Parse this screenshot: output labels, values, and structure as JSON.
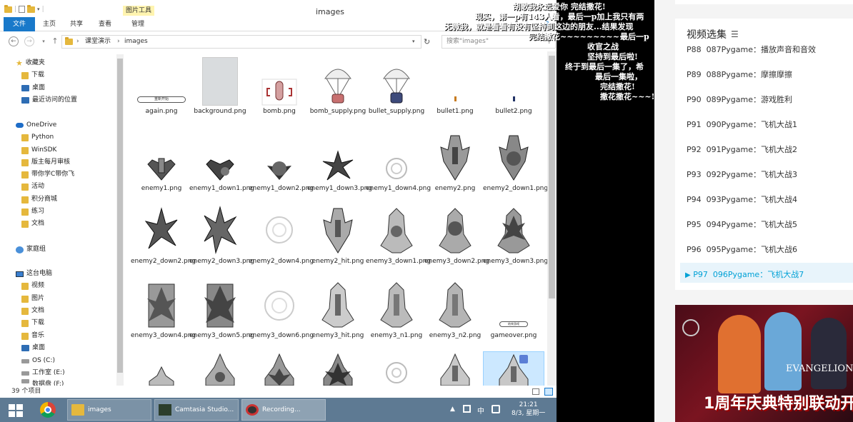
{
  "explorer": {
    "window_title": "images",
    "context_tab": "图片工具",
    "ribbon_tabs": [
      "文件",
      "主页",
      "共享",
      "查看",
      "管理"
    ],
    "breadcrumb": [
      "课堂演示",
      "images"
    ],
    "search_placeholder": "搜索\"images\"",
    "nav": {
      "favorites": "收藏夹",
      "fav_items": [
        "下载",
        "桌面",
        "最近访问的位置"
      ],
      "onedrive": "OneDrive",
      "od_items": [
        "Python",
        "WinSDK",
        "版主每月审核",
        "带你学C带你飞",
        "活动",
        "积分商城",
        "练习",
        "文档"
      ],
      "homegroup": "家庭组",
      "thispc": "这台电脑",
      "pc_items": [
        "视频",
        "图片",
        "文档",
        "下载",
        "音乐",
        "桌面",
        "OS (C:)",
        "工作室 (E:)",
        "数据盘 (F:)"
      ]
    },
    "files": [
      "again.png",
      "background.png",
      "bomb.png",
      "bomb_supply.png",
      "bullet_supply.png",
      "bullet1.png",
      "bullet2.png",
      "enemy1.png",
      "enemy1_down1.png",
      "enemy1_down2.png",
      "enemy1_down3.png",
      "enemy1_down4.png",
      "enemy2.png",
      "enemy2_down1.png",
      "enemy2_down2.png",
      "enemy2_down3.png",
      "enemy2_down4.png",
      "enemy2_hit.png",
      "enemy3_down1.png",
      "enemy3_down2.png",
      "enemy3_down3.png",
      "enemy3_down4.png",
      "enemy3_down5.png",
      "enemy3_down6.png",
      "enemy3_hit.png",
      "enemy3_n1.png",
      "enemy3_n2.png",
      "gameover.png"
    ],
    "again_label": "重新开始",
    "gameover_label": "结束游戏",
    "status": "39 个项目"
  },
  "taskbar": {
    "buttons": [
      "images",
      "Camtasia Studio...",
      "Recording..."
    ],
    "tray": "中",
    "time": "21:21",
    "date": "8/3, 星期一"
  },
  "danmaku": [
    "胡歌我永远爱你  完结撒花!",
    "现实，第一p有143人看，最后一p加上我只有两",
    "无微我，就是看看有没有坚持到这边的朋友...结果发现",
    "完结撒花~~~~~~~~~~~~~~~~~~~~~~~",
    "最后一p",
    "收官之战",
    "坚持到最后啦!",
    "终于到最后一集了，希",
    "最后一集啦，",
    "完结撒花!",
    "撒花撒花~~~!"
  ],
  "sidebar": {
    "playlist_title": "视频选集",
    "items": [
      {
        "p": "P88",
        "t": "087Pygame：播放声音和音效"
      },
      {
        "p": "P89",
        "t": "088Pygame：摩擦摩擦"
      },
      {
        "p": "P90",
        "t": "089Pygame：游戏胜利"
      },
      {
        "p": "P91",
        "t": "090Pygame：飞机大战1"
      },
      {
        "p": "P92",
        "t": "091Pygame：飞机大战2"
      },
      {
        "p": "P93",
        "t": "092Pygame：飞机大战3"
      },
      {
        "p": "P94",
        "t": "093Pygame：飞机大战4"
      },
      {
        "p": "P95",
        "t": "094Pygame：飞机大战5"
      },
      {
        "p": "P96",
        "t": "095Pygame：飞机大战6"
      },
      {
        "p": "P97",
        "t": "096Pygame：飞机大战7"
      }
    ],
    "banner_text": "1周年庆典特别联动开",
    "banner_evangelion": "EVANGELION"
  },
  "colors": {
    "accent": "#1979ca",
    "active": "#00a1d6"
  }
}
